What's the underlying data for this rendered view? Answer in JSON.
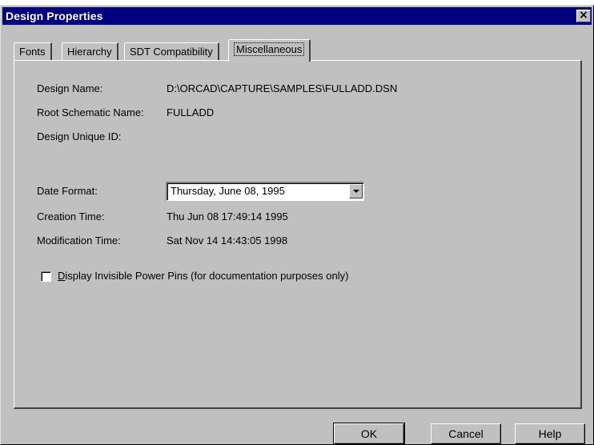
{
  "window": {
    "title": "Design Properties",
    "close_glyph": "×"
  },
  "tabs": [
    {
      "label": "Fonts"
    },
    {
      "label": "Hierarchy"
    },
    {
      "label": "SDT Compatibility"
    },
    {
      "label": "Miscellaneous",
      "active": true
    }
  ],
  "misc": {
    "design_name_label": "Design Name:",
    "design_name_value": "D:\\ORCAD\\CAPTURE\\SAMPLES\\FULLADD.DSN",
    "root_label": "Root Schematic Name:",
    "root_value": "FULLADD",
    "unique_id_label": "Design Unique ID:",
    "unique_id_value": "",
    "date_format_label": "Date Format:",
    "date_format_value": "Thursday, June 08, 1995",
    "creation_label": "Creation Time:",
    "creation_value": "Thu Jun 08 17:49:14 1995",
    "modification_label": "Modification Time:",
    "modification_value": "Sat Nov 14 14:43:05 1998",
    "checkbox_accel": "D",
    "checkbox_rest": "isplay Invisible Power Pins (for documentation purposes only)",
    "checkbox_checked": false
  },
  "buttons": {
    "ok": "OK",
    "cancel": "Cancel",
    "help": "Help"
  },
  "icons": {
    "dropdown": "chevron-down-icon"
  },
  "colors": {
    "titlebar": "#000080",
    "face": "#c0c0c0"
  }
}
